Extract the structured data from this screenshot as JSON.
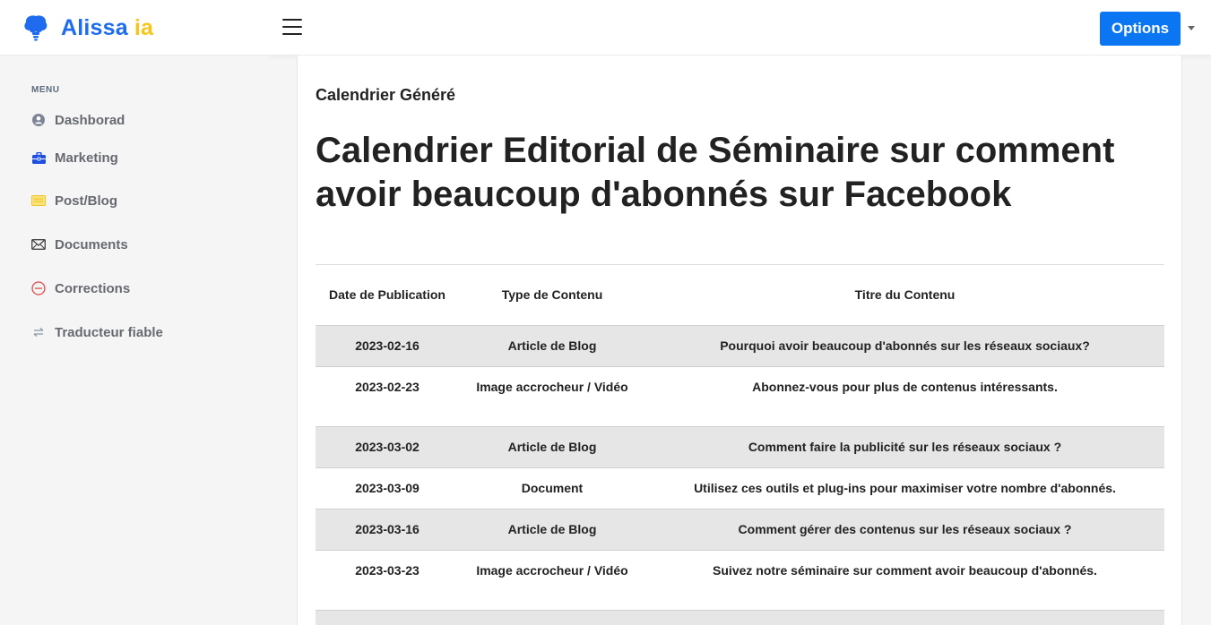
{
  "header": {
    "logo_primary": "Alissa",
    "logo_secondary": "ia",
    "options_label": "Options"
  },
  "colors": {
    "brand_blue": "#1f6bef",
    "brand_yellow": "#f7c518",
    "button_blue": "#0b76f2"
  },
  "sidebar": {
    "menu_label": "MENU",
    "items": [
      {
        "label": "Dashborad",
        "icon": "user-circle-icon",
        "color": "#7c8596"
      },
      {
        "label": "Marketing",
        "icon": "briefcase-icon",
        "color": "#1f4fe0"
      },
      {
        "label": "Post/Blog",
        "icon": "card-icon",
        "color": "#f2c42b"
      },
      {
        "label": "Documents",
        "icon": "envelope-icon",
        "color": "#444"
      },
      {
        "label": "Corrections",
        "icon": "minus-circle-icon",
        "color": "#e04b4b"
      },
      {
        "label": "Traducteur fiable",
        "icon": "swap-arrows-icon",
        "color": "#8a97a8"
      }
    ]
  },
  "main": {
    "subtitle": "Calendrier Généré",
    "title": "Calendrier Editorial de Séminaire sur comment avoir beaucoup d'abonnés sur Facebook",
    "table": {
      "headers": [
        "Date de Publication",
        "Type de Contenu",
        "Titre du Contenu"
      ],
      "rows": [
        [
          "2023-02-16",
          "Article de Blog",
          "Pourquoi avoir beaucoup d'abonnés sur les réseaux sociaux?"
        ],
        [
          "2023-02-23",
          "Image accrocheur / Vidéo",
          "Abonnez-vous pour plus de contenus intéressants."
        ],
        [
          "2023-03-02",
          "Article de Blog",
          "Comment faire la publicité sur les réseaux sociaux ?"
        ],
        [
          "2023-03-09",
          "Document",
          "Utilisez ces outils et plug-ins pour maximiser votre nombre d'abonnés."
        ],
        [
          "2023-03-16",
          "Article de Blog",
          "Comment gérer des contenus sur les réseaux sociaux ?"
        ],
        [
          "2023-03-23",
          "Image accrocheur / Vidéo",
          "Suivez notre séminaire sur comment avoir beaucoup d'abonnés."
        ]
      ]
    }
  }
}
